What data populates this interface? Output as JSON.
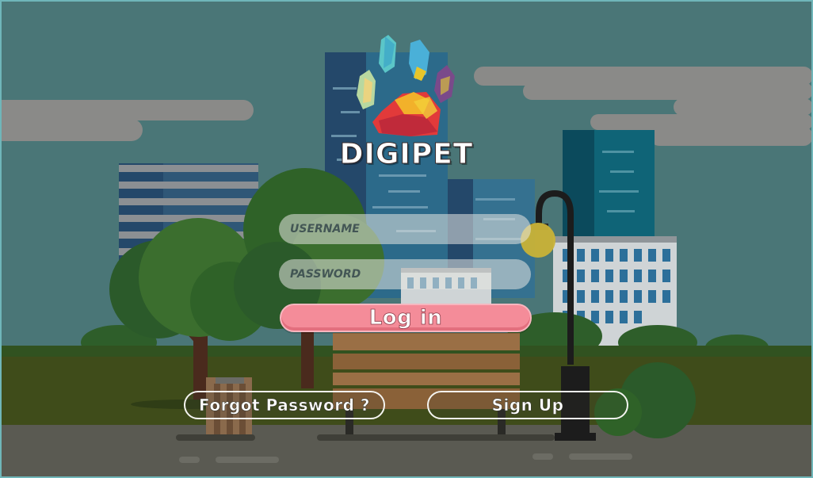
{
  "app": {
    "title": "DIGIPET"
  },
  "login_form": {
    "username_placeholder": "USERNAME",
    "password_placeholder": "PASSWORD",
    "login_label": "Log in"
  },
  "footer_buttons": {
    "forgot_password_label": "Forgot Password ?",
    "sign_up_label": "Sign Up"
  },
  "colors": {
    "sky": "#4a7677",
    "login_button": "#f48c99",
    "field_fill": "#e6e6e1",
    "grass": "#3f4c1a"
  },
  "icons": {
    "logo": "paw-print-logo-icon"
  }
}
